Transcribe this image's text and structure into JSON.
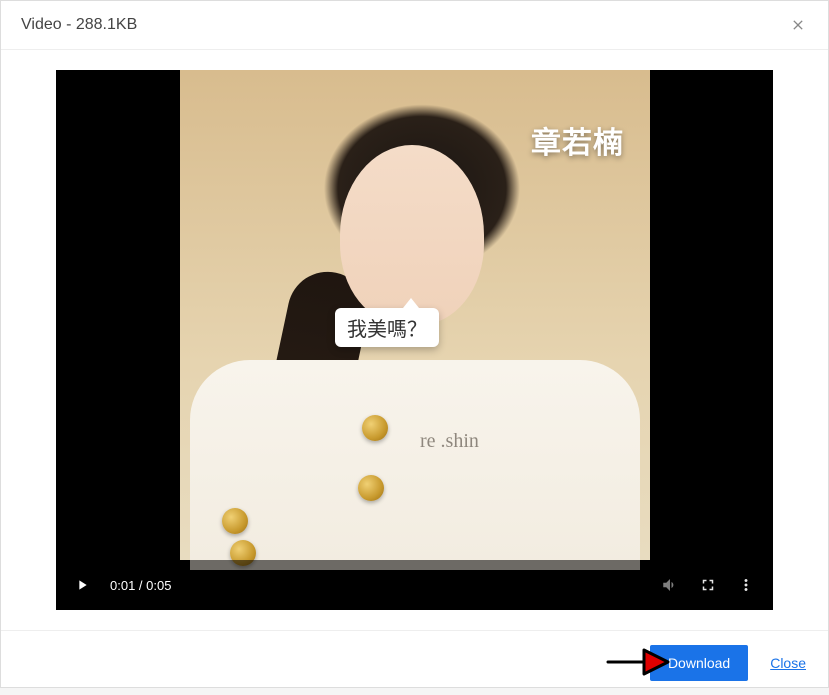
{
  "header": {
    "title": "Video - 288.1KB"
  },
  "video": {
    "caption_name": "章若楠",
    "speech_bubble": "我美嗎？",
    "signature": "re    .shin",
    "time_current": "0:01",
    "time_total": "0:05",
    "time_display": "0:01 / 0:05"
  },
  "footer": {
    "download_label": "Download",
    "close_label": "Close"
  }
}
